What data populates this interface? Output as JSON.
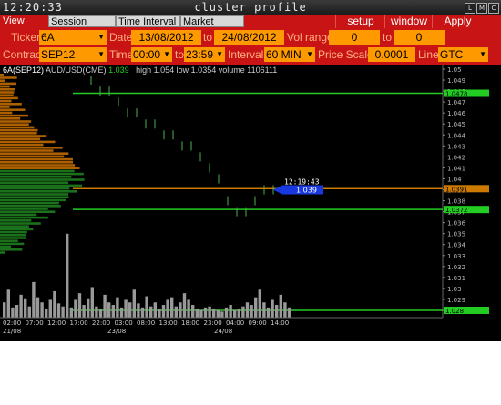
{
  "titlebar": {
    "clock": "12:20:33",
    "title": "cluster profile",
    "buttons": [
      "L",
      "M",
      "C"
    ]
  },
  "menubar": {
    "tabs": [
      {
        "label": "View DOM",
        "active": true
      },
      {
        "label": "Session Hours",
        "active": false
      },
      {
        "label": "Time Interval",
        "active": false
      },
      {
        "label": "Market Watch",
        "active": false
      }
    ],
    "setup_label": "setup",
    "window_label": "window",
    "apply_label": "Apply"
  },
  "controls": {
    "ticker_label": "Ticker",
    "ticker_value": "6A",
    "date_label": "Date",
    "date_from": "13/08/2012",
    "date_to_label": "to",
    "date_to": "24/08/2012",
    "vol_range_label": "Vol range",
    "vol_from": "0",
    "vol_to_label": "to",
    "vol_to": "0",
    "contract_label": "Contract",
    "contract_value": "SEP12",
    "time_label": "Time",
    "time_from": "00:00",
    "time_to_label": "to",
    "time_to": "23:59",
    "interval_label": "Interval",
    "interval_value": "60 MIN",
    "price_scale_label": "Price Scale",
    "price_scale_value": "0.0001",
    "line_label": "Line",
    "line_value": "GTC"
  },
  "chart_info": {
    "symbol": "6A(SEP12)",
    "pair": "AUD/USD(CME)",
    "last": "1.039",
    "high": "high 1.054",
    "low": "low 1.0354",
    "volume": "volume 1106111"
  },
  "colors": {
    "accent_red": "#c81414",
    "field_orange": "#ff9900",
    "profile_orange": "#c06a00",
    "profile_green": "#1e7d1e",
    "price_tag_blue": "#1838e0",
    "line_green": "#22cc22",
    "line_orange": "#cc7a00"
  },
  "chart_data": {
    "type": "bar",
    "y_ticks": [
      "1.05",
      "1.049",
      "1.048",
      "1.047",
      "1.046",
      "1.045",
      "1.044",
      "1.043",
      "1.042",
      "1.041",
      "1.04",
      "1.039",
      "1.038",
      "1.037",
      "1.036",
      "1.035",
      "1.034",
      "1.033",
      "1.032",
      "1.031",
      "1.03",
      "1.029",
      "1.028"
    ],
    "price_tag_time": "12:19:43",
    "price_tag_value": "1.039",
    "green_line_top": "1.0478",
    "orange_line": "1.0391",
    "green_line_mid": "1.0372",
    "green_line_low": "1.028",
    "x_labels": [
      "02:00",
      "07:00",
      "12:00",
      "17:00",
      "22:00",
      "03:00",
      "08:00",
      "13:00",
      "18:00",
      "23:00",
      "04:00",
      "09:00",
      "14:00"
    ],
    "x_dates": [
      "21/08",
      "23/08",
      "24/08"
    ],
    "volumes": [
      30,
      55,
      20,
      25,
      45,
      38,
      22,
      70,
      40,
      30,
      18,
      35,
      52,
      28,
      22,
      165,
      20,
      35,
      48,
      25,
      38,
      60,
      22,
      18,
      45,
      30,
      25,
      40,
      20,
      35,
      30,
      55,
      28,
      20,
      42,
      22,
      30,
      18,
      25,
      35,
      40,
      22,
      30,
      48,
      35,
      25,
      18,
      15,
      20,
      22,
      18,
      15,
      12,
      20,
      25,
      15,
      18,
      22,
      30,
      25,
      40,
      55,
      30,
      20,
      35,
      25,
      45,
      30,
      20
    ]
  }
}
